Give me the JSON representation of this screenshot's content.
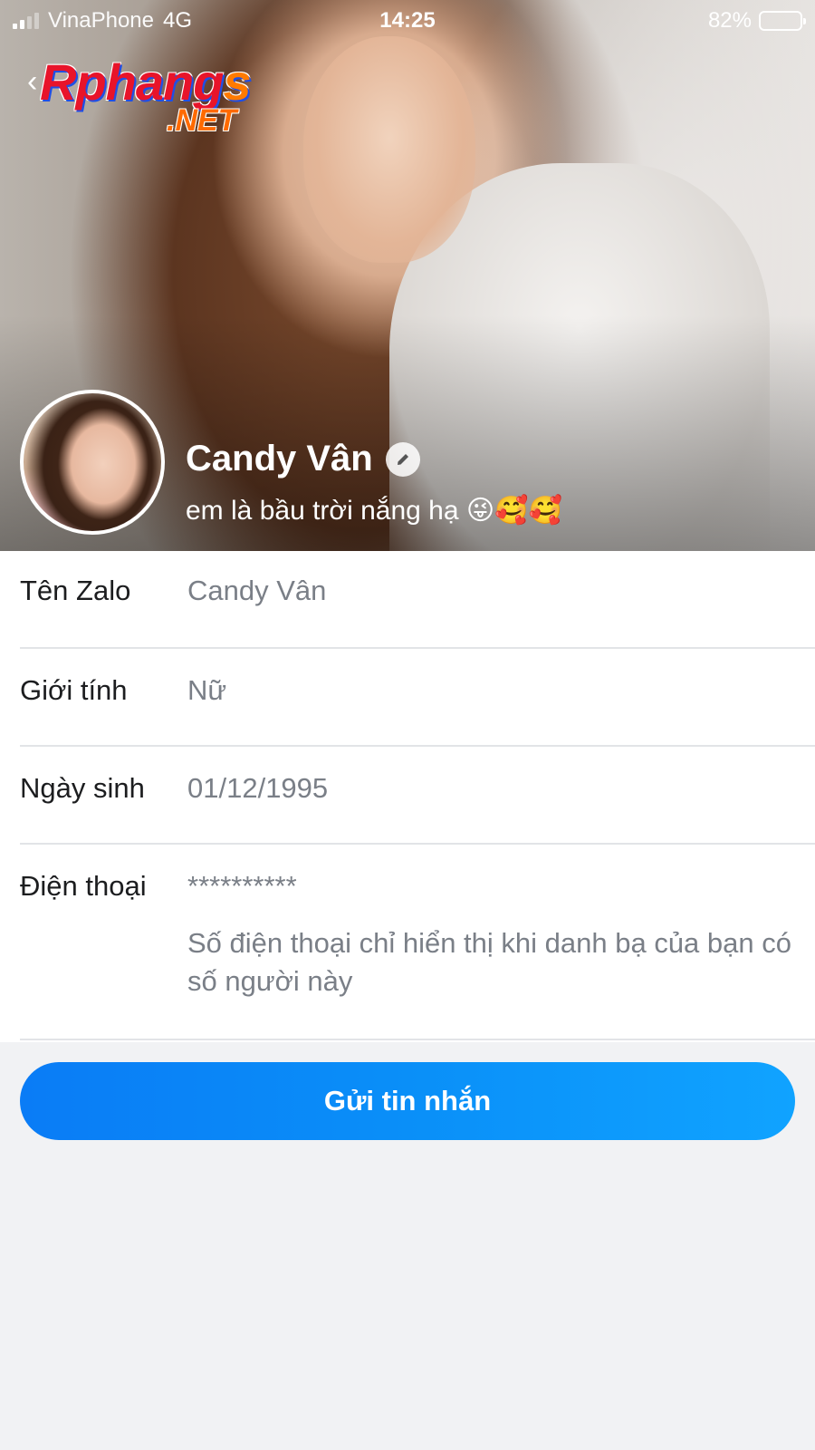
{
  "status_bar": {
    "carrier": "VinaPhone",
    "network": "4G",
    "time": "14:25",
    "battery": "82%",
    "battery_level": 0.82
  },
  "watermark": {
    "main_text": "Rphang",
    "main_suffix": "s",
    "sub_text": ".NET"
  },
  "profile": {
    "name": "Candy Vân",
    "status": "em là bầu trời nắng hạ 😜🥰🥰"
  },
  "info_rows": {
    "zalo_name": {
      "label": "Tên Zalo",
      "value": "Candy Vân"
    },
    "gender": {
      "label": "Giới tính",
      "value": "Nữ"
    },
    "birthday": {
      "label": "Ngày sinh",
      "value": "01/12/1995"
    },
    "phone": {
      "label": "Điện thoại",
      "value": "**********",
      "note": "Số điện thoại chỉ hiển thị khi danh bạ của bạn có số người này"
    }
  },
  "actions": {
    "send_message": "Gửi tin nhắn"
  },
  "colors": {
    "accent": "#0a8ff8",
    "label": "#1c1d1f",
    "value": "#7a7f87",
    "divider": "#e2e4e7",
    "background": "#f1f2f4"
  },
  "icons": {
    "back": "chevron-left-icon",
    "edit": "pencil-icon",
    "signal": "signal-icon",
    "battery": "battery-icon"
  }
}
